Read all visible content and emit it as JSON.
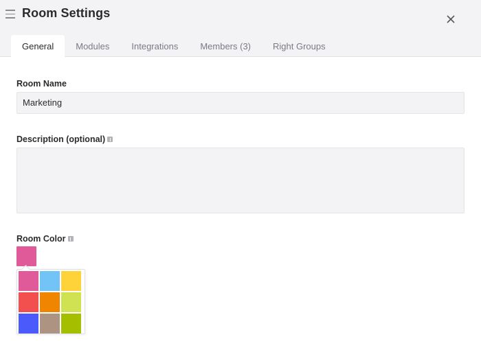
{
  "header": {
    "title": "Room Settings",
    "menu_icon": "hamburger-menu-icon",
    "close_icon": "close-icon"
  },
  "tabs": [
    {
      "label": "General",
      "active": true
    },
    {
      "label": "Modules",
      "active": false
    },
    {
      "label": "Integrations",
      "active": false
    },
    {
      "label": "Members (3)",
      "active": false
    },
    {
      "label": "Right Groups",
      "active": false
    }
  ],
  "form": {
    "room_name": {
      "label": "Room Name",
      "value": "Marketing"
    },
    "description": {
      "label": "Description (optional)",
      "value": "",
      "info_icon": "info-icon"
    },
    "room_color": {
      "label": "Room Color",
      "info_icon": "info-icon",
      "selected": "#e05a9a",
      "palette": [
        "#e05a9a",
        "#72c4f7",
        "#fdd339",
        "#f1504f",
        "#ef8500",
        "#d0e252",
        "#4b5bfb",
        "#ad9382",
        "#a5bf00"
      ]
    }
  }
}
